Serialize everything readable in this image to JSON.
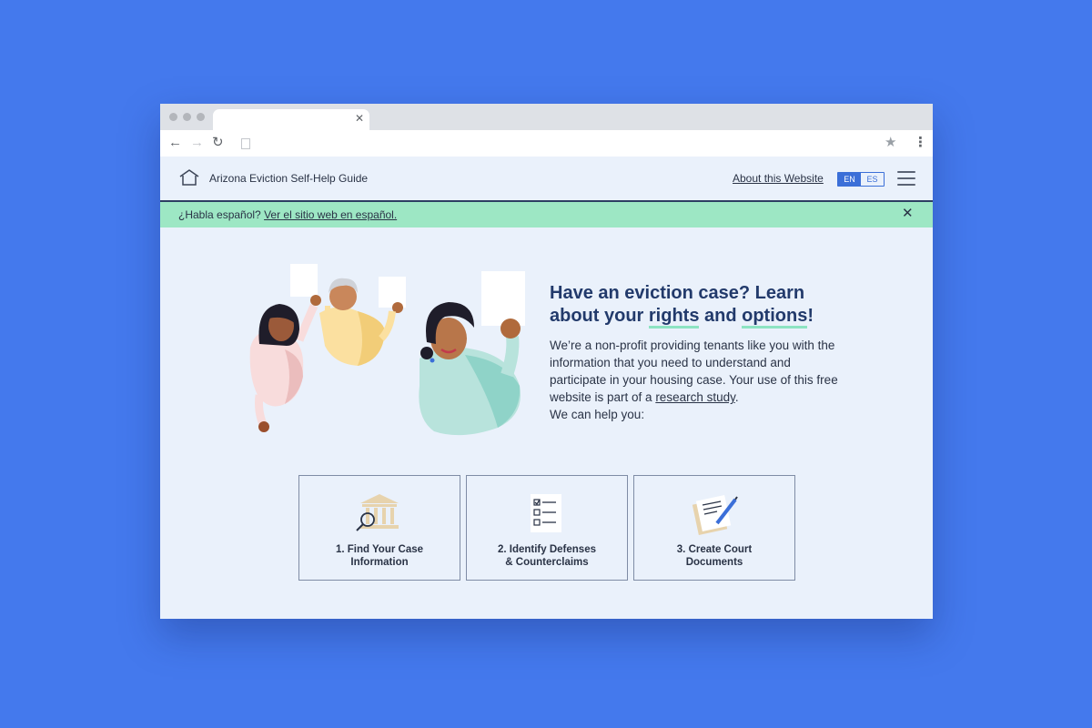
{
  "site": {
    "title": "Arizona Eviction Self-Help Guide"
  },
  "header": {
    "about_link": "About this Website",
    "lang_en": "EN",
    "lang_es": "ES"
  },
  "banner": {
    "prompt": "¿Habla español?",
    "link": "Ver el sitio web en español."
  },
  "hero": {
    "heading_part1": "Have an eviction case? Learn about your ",
    "heading_rights": "rights",
    "heading_and": " and ",
    "heading_options": "options",
    "heading_end": "!",
    "body": "We’re a non-profit providing tenants like you with the information that you need to understand and participate in your housing case. Your use of this free website is part of a ",
    "research_link": "research study",
    "body_end": ".",
    "help": "We can help you:"
  },
  "cards": [
    {
      "line1": "1. Find Your Case",
      "line2": "Information",
      "icon": "courthouse-search-icon"
    },
    {
      "line1": "2. Identify Defenses",
      "line2": "& Counterclaims",
      "icon": "checklist-icon"
    },
    {
      "line1": "3. Create Court",
      "line2": "Documents",
      "icon": "document-pen-icon"
    }
  ],
  "colors": {
    "background": "#4479ed",
    "page": "#eaf1fb",
    "banner": "#9de7c4",
    "heading": "#223a6b",
    "accent": "#3b6fd8"
  }
}
